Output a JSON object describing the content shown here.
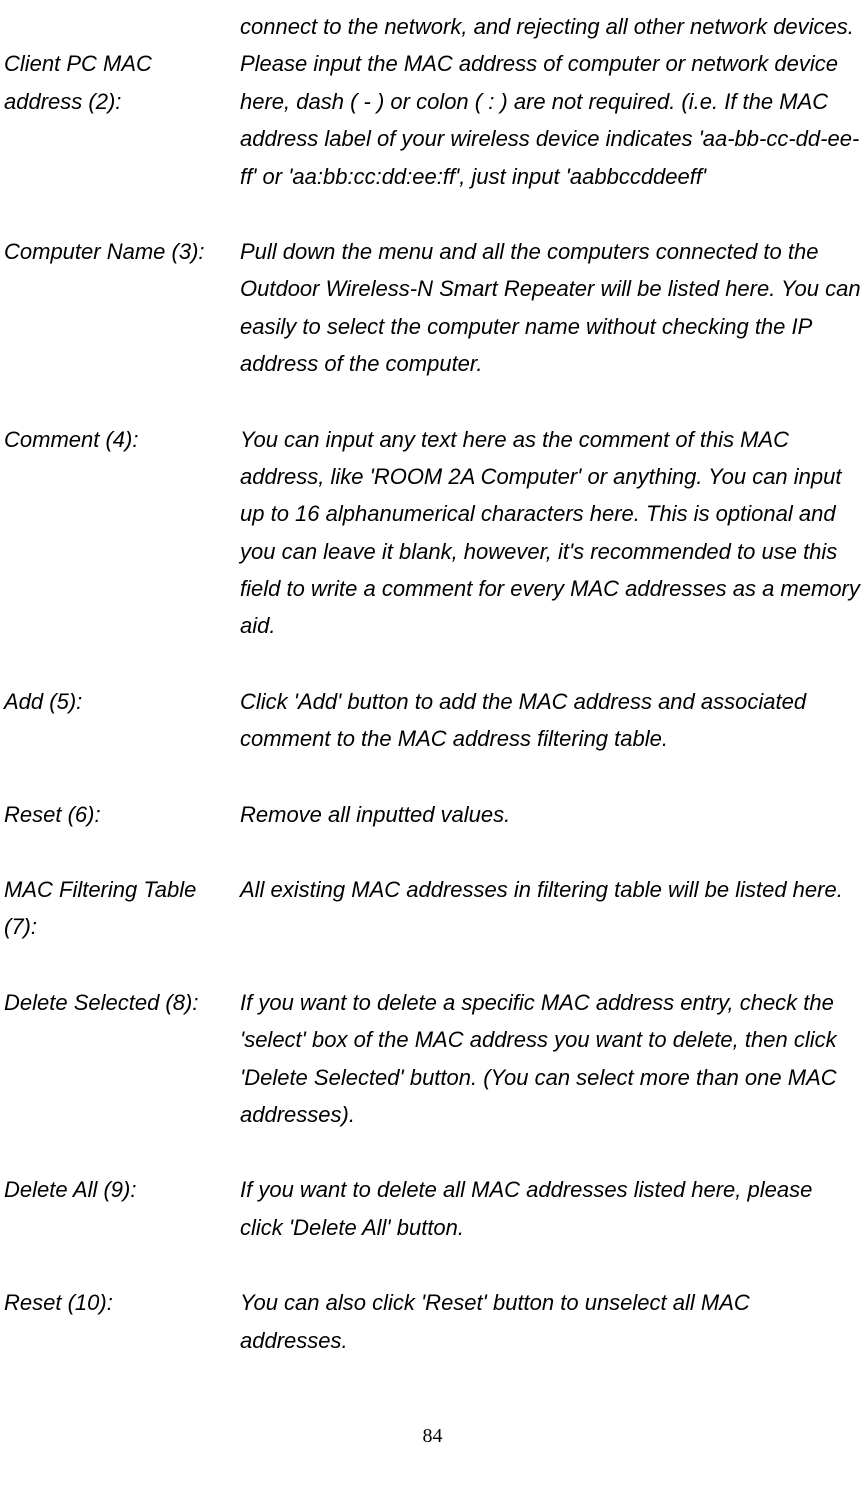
{
  "continuation_text": "connect to the network, and rejecting all other network devices.",
  "entries": [
    {
      "label": "Client PC MAC address (2):",
      "desc": "Please input the MAC address of computer or network device here, dash ( - ) or colon ( : ) are not required. (i.e. If the MAC address label of your wireless device indicates 'aa-bb-cc-dd-ee-ff' or 'aa:bb:cc:dd:ee:ff', just input 'aabbccddeeff'"
    },
    {
      "label": "Computer Name (3):",
      "desc": "Pull down the menu and all the computers connected to the Outdoor Wireless-N Smart Repeater will be listed here. You can easily to select the computer name without checking the IP address of the computer."
    },
    {
      "label": "Comment (4):",
      "desc": "You can input any text here as the comment of this MAC address, like 'ROOM 2A Computer' or anything. You can input up to 16 alphanumerical characters here. This is optional and you can leave it blank, however, it's recommended to use this field to write a comment for every MAC addresses as a memory aid."
    },
    {
      "label": "Add (5):",
      "desc": "Click 'Add' button to add the MAC address and associated comment to the MAC address filtering table."
    },
    {
      "label": "Reset (6):",
      "desc": "Remove all inputted values."
    },
    {
      "label": "MAC Filtering Table (7):",
      "desc": "All existing MAC addresses in filtering table will be listed here."
    },
    {
      "label": "Delete Selected (8):",
      "desc": "If you want to delete a specific MAC address entry, check the 'select' box of the MAC address you want to delete, then click 'Delete Selected' button. (You can select more than one MAC addresses)."
    },
    {
      "label": "Delete All (9):",
      "desc": "If you want to delete all MAC addresses listed here, please click 'Delete All' button."
    },
    {
      "label": "Reset (10):",
      "desc": "You can also click 'Reset' button to unselect all MAC addresses."
    }
  ],
  "page_number": "84"
}
